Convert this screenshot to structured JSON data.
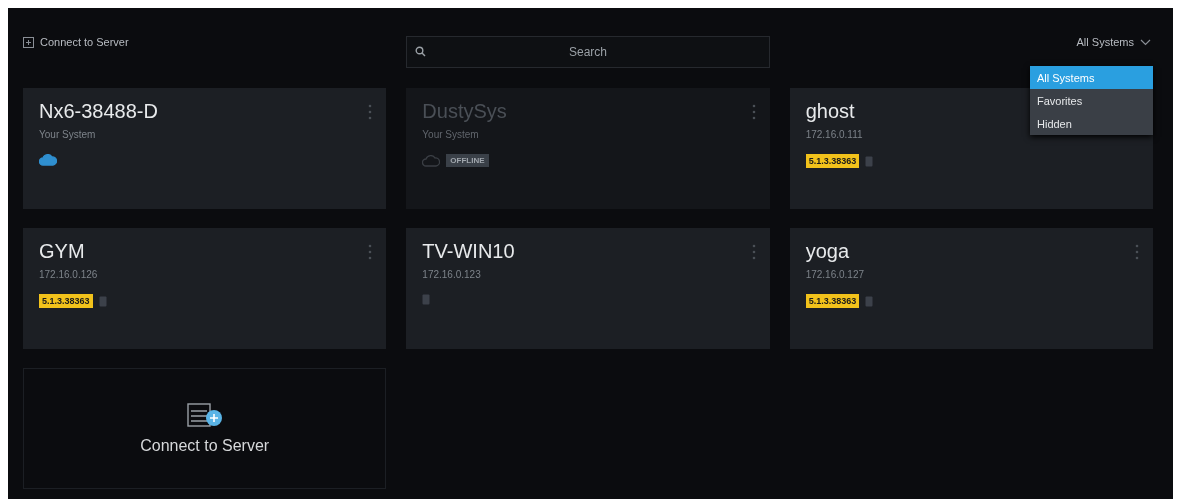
{
  "toolbar": {
    "connect_link": "Connect to Server",
    "search": {
      "placeholder": "Search"
    },
    "filter": {
      "value": "All Systems",
      "expanded": true,
      "options": [
        {
          "label": "All Systems",
          "selected": true
        },
        {
          "label": "Favorites",
          "selected": false
        },
        {
          "label": "Hidden",
          "selected": false
        }
      ]
    }
  },
  "systems": [
    {
      "name": "Nx6-38488-D",
      "subtitle": "Your System",
      "kind": "cloud",
      "online": true
    },
    {
      "name": "DustySys",
      "subtitle": "Your System",
      "kind": "cloud",
      "online": false,
      "status": "OFFLINE"
    },
    {
      "name": "ghost",
      "subtitle": "172.16.0.111",
      "kind": "local",
      "online": true,
      "version": "5.1.3.38363"
    },
    {
      "name": "GYM",
      "subtitle": "172.16.0.126",
      "kind": "local",
      "online": true,
      "version": "5.1.3.38363"
    },
    {
      "name": "TV-WIN10",
      "subtitle": "172.16.0.123",
      "kind": "local",
      "online": true
    },
    {
      "name": "yoga",
      "subtitle": "172.16.0.127",
      "kind": "local",
      "online": true,
      "version": "5.1.3.38363"
    }
  ],
  "connect_tile": {
    "label": "Connect to Server"
  }
}
